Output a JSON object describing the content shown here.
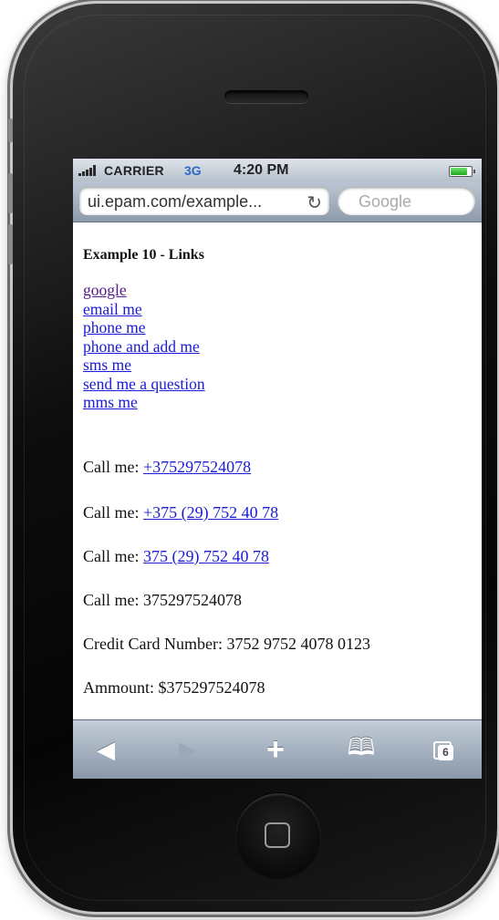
{
  "status_bar": {
    "carrier": "CARRIER",
    "network": "3G",
    "time": "4:20 PM",
    "battery_level": 0.9
  },
  "address_bar": {
    "url": "ui.epam.com/example...",
    "search_placeholder": "Google"
  },
  "page": {
    "heading": "Example 10 - Links",
    "links": [
      "google",
      "email me",
      "phone me",
      "phone and add me",
      "sms me",
      "send me a question",
      "mms me"
    ],
    "call_label": "Call me:",
    "call_link_1": "+375297524078",
    "call_link_2": "+375 (29) 752 40 78",
    "call_link_3": "375 (29) 752 40 78",
    "call_plain": "375297524078",
    "credit_card_label": "Credit Card Number:",
    "credit_card_value": "3752 9752 4078 0123",
    "amount_label": "Ammount:",
    "amount_value": "$375297524078"
  },
  "toolbar": {
    "tabs_count": "6",
    "icons": [
      "back-icon",
      "forward-icon",
      "add-icon",
      "bookmarks-icon",
      "pages-icon"
    ]
  },
  "colors": {
    "link": "#1a1ad8",
    "visited_link": "#551a8b",
    "network": "#2a6ac8"
  }
}
